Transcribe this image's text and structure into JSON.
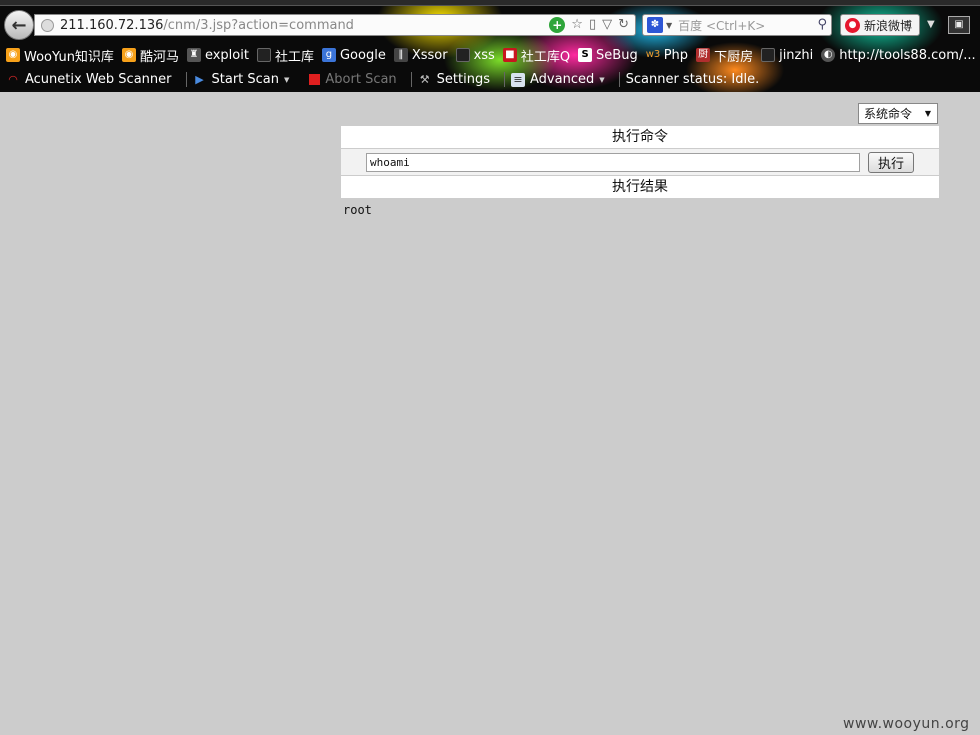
{
  "browser": {
    "url_host": "211.160.72.136",
    "url_path": "/cnm/3.jsp?action=command",
    "search_placeholder": "百度 <Ctrl+K>",
    "weibo_label": "新浪微博"
  },
  "bookmarks": [
    {
      "label": "WooYun知识库",
      "icon": "rss-icon"
    },
    {
      "label": "酷河马",
      "icon": "rss-icon"
    },
    {
      "label": "exploit",
      "icon": "figure-icon"
    },
    {
      "label": "社工库",
      "icon": "page-icon"
    },
    {
      "label": "Google",
      "icon": "google-icon"
    },
    {
      "label": "Xssor",
      "icon": "xssor-icon"
    },
    {
      "label": "xss",
      "icon": "page-icon"
    },
    {
      "label": "社工库Q",
      "icon": "red-icon"
    },
    {
      "label": "SeBug",
      "icon": "sebug-icon"
    },
    {
      "label": "Php",
      "icon": "w3-icon"
    },
    {
      "label": "下厨房",
      "icon": "cook-icon"
    },
    {
      "label": "jinzhi",
      "icon": "page-icon"
    },
    {
      "label": "http://tools88.com/...",
      "icon": "tools-icon"
    }
  ],
  "scanner": {
    "name": "Acunetix Web Scanner",
    "start_scan": "Start Scan",
    "abort_scan": "Abort Scan",
    "settings": "Settings",
    "advanced": "Advanced",
    "status": "Scanner status: Idle."
  },
  "page": {
    "select_value": "系统命令",
    "exec_header": "执行命令",
    "command_value": "whoami",
    "exec_button": "执行",
    "result_header": "执行结果",
    "result_text": "root",
    "watermark": "www.wooyun.org"
  }
}
